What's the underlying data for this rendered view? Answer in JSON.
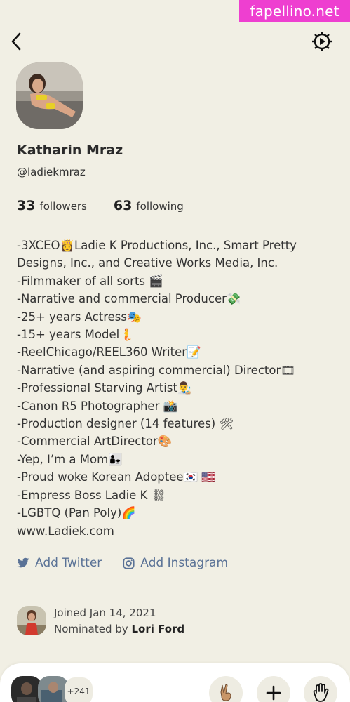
{
  "watermark": "fapellino.net",
  "header": {
    "back_icon": "chevron-left-icon",
    "settings_icon": "gear-icon"
  },
  "profile": {
    "name": "Katharin Mraz",
    "handle": "@ladiekmraz",
    "followers_count": "33",
    "followers_label": "followers",
    "following_count": "63",
    "following_label": "following"
  },
  "bio": [
    "-3XCEO👸Ladie K Productions, Inc., Smart Pretty Designs, Inc., and Creative Works Media, Inc.",
    "-Filmmaker of all sorts 🎬",
    "-Narrative and commercial Producer💸",
    "-25+ years Actress🎭",
    "-15+ years Model🧜",
    "-ReelChicago/REEL360 Writer📝",
    "-Narrative (and aspiring commercial) Director🎞",
    "-Professional Starving Artist👨‍🎨",
    "-Canon R5 Photographer 📸",
    "-Production designer (14 features) 🛠",
    "-Commercial ArtDirector🎨",
    "-Yep, I’m a Mom👨‍👧",
    "-Proud woke Korean Adoptee🇰🇷 🇺🇸",
    "-Empress Boss Ladie K ⛓",
    "-LGBTQ (Pan Poly)🌈",
    "www.Ladiek.com"
  ],
  "social": {
    "twitter_label": "Add Twitter",
    "instagram_label": "Add Instagram"
  },
  "joined": {
    "joined_text": "Joined Jan 14, 2021",
    "nominated_prefix": "Nominated by",
    "nominated_by": "Lori Ford"
  },
  "bottom_bar": {
    "participant_count": "+241",
    "raise_hand_icon": "hand-icon",
    "add_icon": "plus-icon",
    "peace_icon": "peace-hand-icon"
  },
  "colors": {
    "background": "#f1efe4",
    "link": "#5a7296",
    "watermark": "#ee3fd0"
  }
}
